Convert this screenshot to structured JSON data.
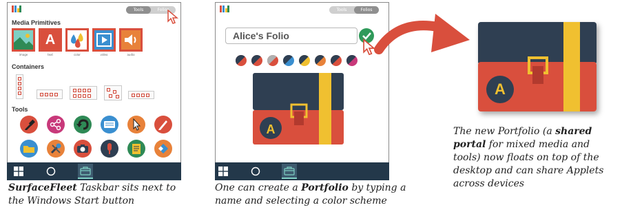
{
  "panel1": {
    "toggle": {
      "tools_label": "Tools",
      "folios_label": "Folios"
    },
    "media_title": "Media Primitives",
    "media_items": [
      {
        "label": "image",
        "icon": "image-icon"
      },
      {
        "label": "text",
        "icon": "text-icon",
        "glyph": "A"
      },
      {
        "label": "color",
        "icon": "color-drops-icon"
      },
      {
        "label": "video",
        "icon": "video-play-icon"
      },
      {
        "label": "audio",
        "icon": "speaker-icon"
      }
    ],
    "containers_title": "Containers",
    "tools_title": "Tools",
    "tools": [
      {
        "icon": "eyedropper-icon",
        "color": "#d94f3d"
      },
      {
        "icon": "share-icon",
        "color": "#c8397a"
      },
      {
        "icon": "undo-icon",
        "color": "#2f8a56"
      },
      {
        "icon": "keyboard-icon",
        "color": "#3a8fd0"
      },
      {
        "icon": "pointer-icon",
        "color": "#e8823a"
      },
      {
        "icon": "pen-icon",
        "color": "#d94f3d"
      },
      {
        "icon": "folder-icon",
        "color": "#3a8fd0"
      },
      {
        "icon": "tools-icon",
        "color": "#e8823a"
      },
      {
        "icon": "camera-icon",
        "color": "#d94f3d"
      },
      {
        "icon": "microphone-icon",
        "color": "#2f3f52"
      },
      {
        "icon": "document-icon",
        "color": "#2f8a56"
      },
      {
        "icon": "eraser-icon",
        "color": "#e8823a"
      }
    ]
  },
  "panel2": {
    "toggle": {
      "tools_label": "Tools",
      "folios_label": "Folios"
    },
    "name_value": "Alice's Folio",
    "swatches": [
      {
        "top": "#2f3f52",
        "bottom": "#d94f3d"
      },
      {
        "top": "#2f3f52",
        "bottom": "#d94f3d"
      },
      {
        "top": "#b0b0b0",
        "bottom": "#d94f3d"
      },
      {
        "top": "#2f3f52",
        "bottom": "#3a8fd0"
      },
      {
        "top": "#2f3f52",
        "bottom": "#f0c030"
      },
      {
        "top": "#2f3f52",
        "bottom": "#e8823a"
      },
      {
        "top": "#2f3f52",
        "bottom": "#d94f3d"
      },
      {
        "top": "#2f3f52",
        "bottom": "#c8397a"
      }
    ],
    "portfolio_letter": "A"
  },
  "panel3": {
    "portfolio_letter": "A"
  },
  "colors": {
    "taskbar": "#23384a",
    "accent_red": "#d94f3d",
    "lid": "#2f3f52",
    "strap": "#f0c030",
    "confirm_green": "#2f9a5a"
  },
  "captions": {
    "c1_bold": "SurfaceFleet",
    "c1_rest": " Taskbar sits next to",
    "c1_line2": "the Windows Start button",
    "c2_pre": "One can create a ",
    "c2_bold": "Portfolio",
    "c2_rest": " by typing a",
    "c2_line2": "name and selecting a color scheme",
    "c3_line1": "The new Portfolio (a ",
    "c3_bold1": "shared",
    "c3_bold2": "portal",
    "c3_line2_rest": " for mixed media and",
    "c3_line3": "tools) now floats on top of the",
    "c3_line4": "desktop and can share Applets",
    "c3_line5": "across devices"
  }
}
